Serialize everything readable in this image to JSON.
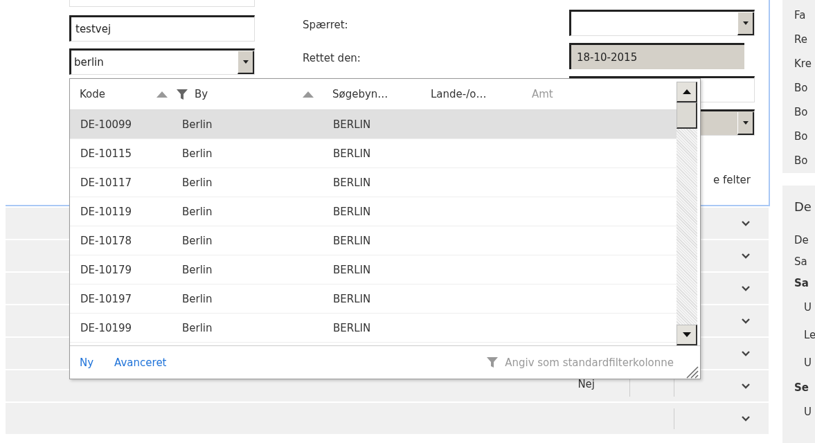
{
  "form": {
    "address": "testvej",
    "city": "berlin",
    "labels": [
      "Spærret:",
      "Rettet den:"
    ],
    "right_fields": [
      {
        "kind": "dropdown",
        "disabled": false
      },
      {
        "kind": "date",
        "value": "18-10-2015"
      },
      {
        "kind": "text"
      },
      {
        "kind": "dropdown",
        "disabled": true
      }
    ],
    "cut_label": "e felter"
  },
  "lookup": {
    "columns": [
      {
        "label": "Kode",
        "sorted": true,
        "filtered": false,
        "dimmed": false
      },
      {
        "label": "By",
        "sorted": true,
        "filtered": true,
        "dimmed": false
      },
      {
        "label": "Søgebyn…",
        "sorted": false,
        "filtered": false,
        "dimmed": false
      },
      {
        "label": "Lande-/o…",
        "sorted": false,
        "filtered": false,
        "dimmed": false
      },
      {
        "label": "Amt",
        "sorted": false,
        "filtered": false,
        "dimmed": true
      }
    ],
    "rows": [
      {
        "code": "DE-10099",
        "city": "Berlin",
        "search_name": "BERLIN",
        "selected": true
      },
      {
        "code": "DE-10115",
        "city": "Berlin",
        "search_name": "BERLIN",
        "selected": false
      },
      {
        "code": "DE-10117",
        "city": "Berlin",
        "search_name": "BERLIN",
        "selected": false
      },
      {
        "code": "DE-10119",
        "city": "Berlin",
        "search_name": "BERLIN",
        "selected": false
      },
      {
        "code": "DE-10178",
        "city": "Berlin",
        "search_name": "BERLIN",
        "selected": false
      },
      {
        "code": "DE-10179",
        "city": "Berlin",
        "search_name": "BERLIN",
        "selected": false
      },
      {
        "code": "DE-10197",
        "city": "Berlin",
        "search_name": "BERLIN",
        "selected": false
      },
      {
        "code": "DE-10199",
        "city": "Berlin",
        "search_name": "BERLIN",
        "selected": false
      }
    ],
    "links": [
      "Ny",
      "Avanceret"
    ],
    "filter_hint": "Angiv som standardfilterkolonne"
  },
  "sections": [
    {
      "kind": "plain",
      "expanded": false
    },
    {
      "kind": "plain",
      "expanded": false
    },
    {
      "kind": "plain",
      "expanded": false
    },
    {
      "kind": "plain",
      "expanded": false
    },
    {
      "kind": "plain",
      "expanded": false
    },
    {
      "kind": "field",
      "expanded": false,
      "value": "Nej"
    },
    {
      "kind": "field",
      "expanded": false
    }
  ],
  "factbox_top": [
    "Fa",
    "Re",
    "Kre",
    "Bo",
    "Bo",
    "Bo",
    "Bo"
  ],
  "factbox_bottom": {
    "title": "De",
    "items": [
      {
        "kind": "line",
        "text": "De"
      },
      {
        "kind": "line",
        "text": "Sa"
      },
      {
        "kind": "group",
        "text": "Sa"
      },
      {
        "kind": "sub",
        "text": "U"
      },
      {
        "kind": "sub",
        "text": "Le"
      },
      {
        "kind": "sub",
        "text": "U"
      },
      {
        "kind": "group",
        "text": "Se"
      },
      {
        "kind": "sub",
        "text": "U"
      }
    ]
  }
}
